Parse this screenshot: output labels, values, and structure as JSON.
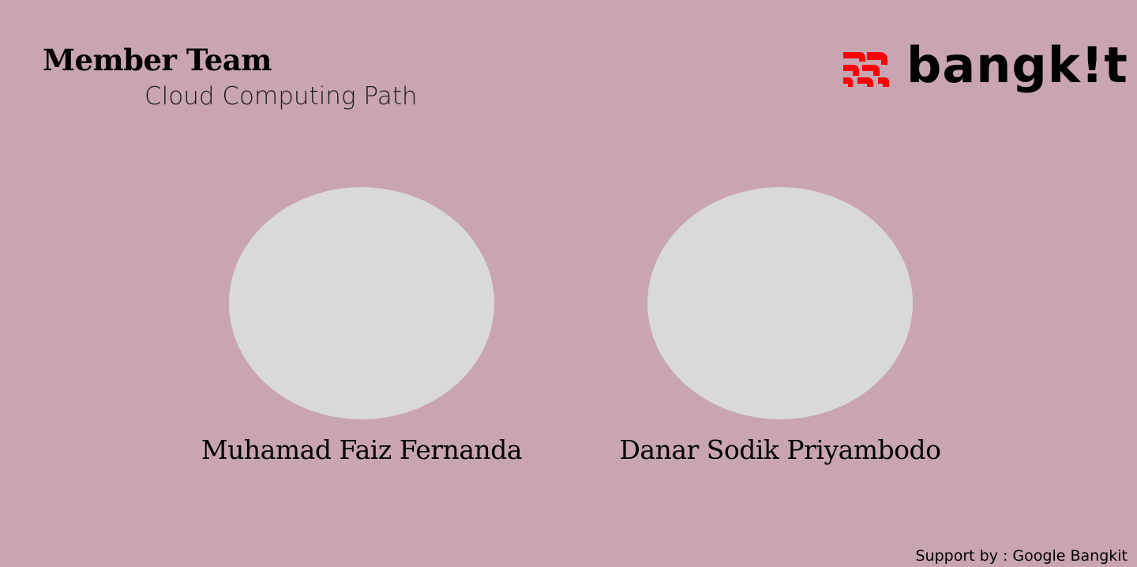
{
  "header": {
    "title": "Member Team",
    "subtitle": "Cloud Computing Path"
  },
  "logo": {
    "text": "bangk!t",
    "mark_color": "#FF0000",
    "icon": "bangkit-logo-mark-icon"
  },
  "members": [
    {
      "name": "Muhamad Faiz Fernanda"
    },
    {
      "name": "Danar Sodik Priyambodo"
    }
  ],
  "footer": {
    "text": "Support by : Google Bangkit"
  },
  "colors": {
    "background": "#C9A5B2",
    "avatar_placeholder": "#D9D9D9"
  }
}
